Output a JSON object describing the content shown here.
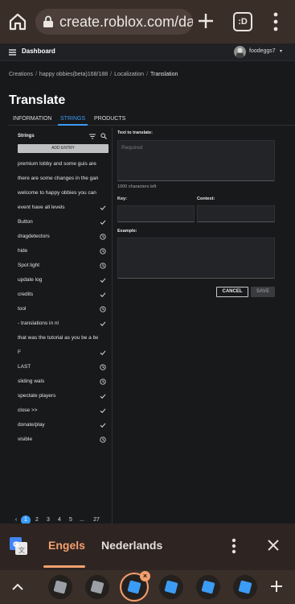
{
  "browser": {
    "url": "create.roblox.com/dashboard/creations/experiences",
    "tab_count": ":D"
  },
  "topbar": {
    "title": "Dashboard",
    "username": "foodeggs7"
  },
  "breadcrumb": [
    "Creations",
    "happy obbies(beta)168/188",
    "Localization",
    "Translation"
  ],
  "page_title": "Translate",
  "tabs": [
    "INFORMATION",
    "STRINGS",
    "PRODUCTS"
  ],
  "strings_panel": {
    "header": "Strings",
    "add_entry": "ADD ENTRY",
    "items": [
      {
        "text": "premium lobby and some guis are b",
        "status": "none"
      },
      {
        "text": "there are some changes in the game",
        "status": "none"
      },
      {
        "text": "welcome to happy obbies you can p",
        "status": "none"
      },
      {
        "text": "event have all levels",
        "status": "check"
      },
      {
        "text": "Button",
        "status": "check"
      },
      {
        "text": "dragdetectors",
        "status": "clock"
      },
      {
        "text": "hide",
        "status": "clock"
      },
      {
        "text": "Spot light",
        "status": "clock"
      },
      {
        "text": "update log",
        "status": "check"
      },
      {
        "text": "credits",
        "status": "check"
      },
      {
        "text": "tool",
        "status": "clock"
      },
      {
        "text": "- translations in nl",
        "status": "check"
      },
      {
        "text": "that was the tutorial as you be a bet",
        "status": "none"
      },
      {
        "text": "F",
        "status": "check"
      },
      {
        "text": "LAST",
        "status": "clock"
      },
      {
        "text": "sliding wals",
        "status": "clock"
      },
      {
        "text": "spectate players",
        "status": "check"
      },
      {
        "text": "close >>",
        "status": "check"
      },
      {
        "text": "donate/play",
        "status": "check"
      },
      {
        "text": "visible",
        "status": "clock"
      }
    ],
    "pagination": {
      "prev": "‹",
      "pages": [
        "1",
        "2",
        "3",
        "4",
        "5",
        "...",
        "27"
      ],
      "next": "›",
      "current": "1"
    }
  },
  "form": {
    "text_label": "Text to translate:",
    "text_placeholder": "Required",
    "chars_left": "1000 characters left",
    "key_label": "Key:",
    "context_label": "Context:",
    "example_label": "Example:",
    "cancel": "CANCEL",
    "save": "SAVE"
  },
  "translate_bar": {
    "source_lang": "Engels",
    "target_lang": "Nederlands"
  },
  "colors": {
    "accent": "#3b9cf6",
    "browser_accent": "#f3a06d"
  }
}
